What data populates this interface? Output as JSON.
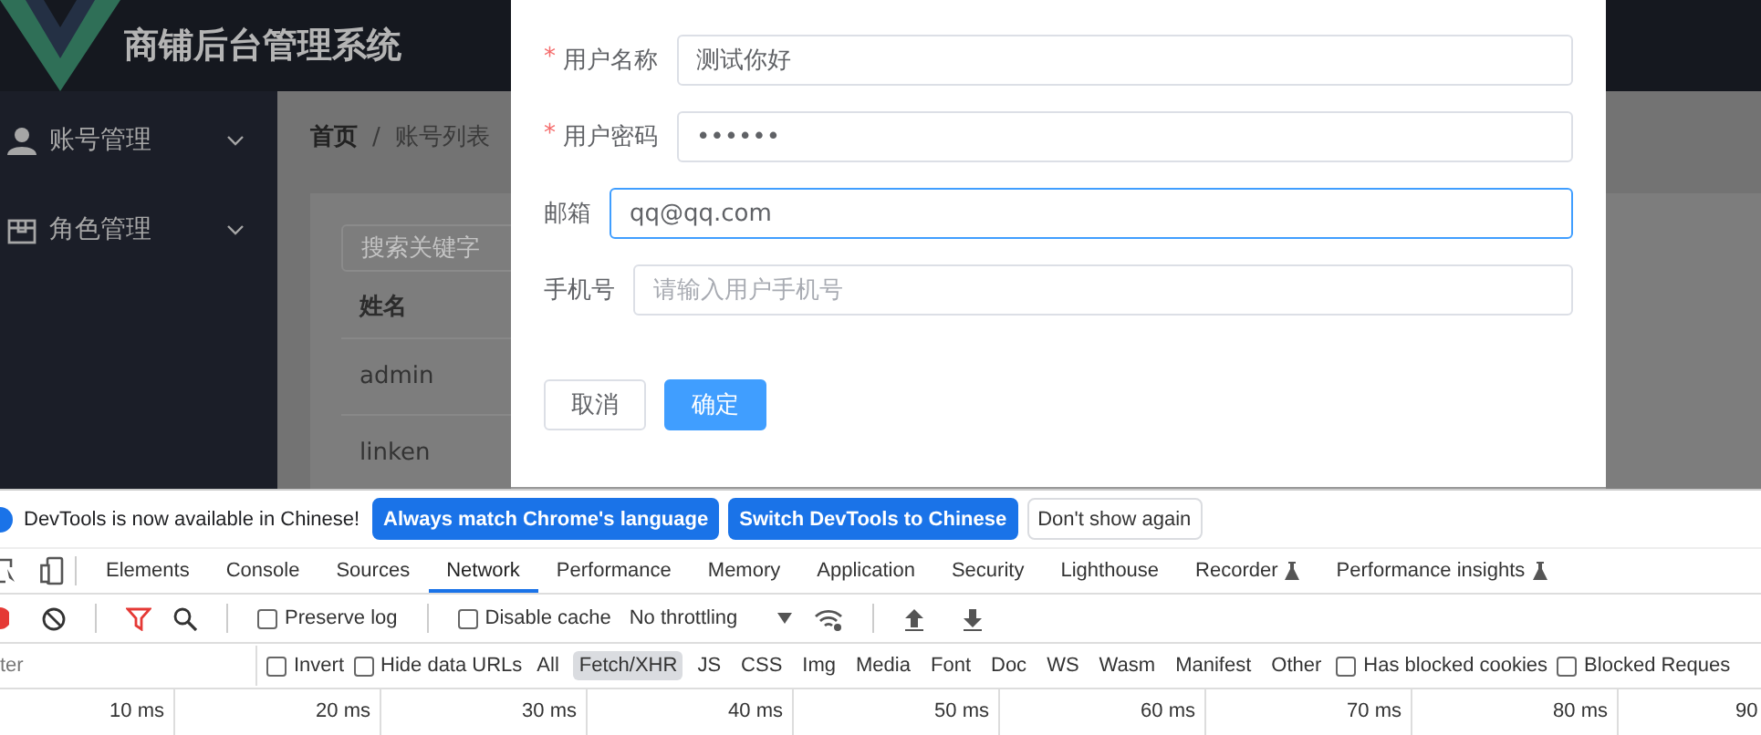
{
  "app": {
    "title": "商铺后台管理系统",
    "menu": [
      {
        "label": "账号管理"
      },
      {
        "label": "角色管理"
      }
    ],
    "breadcrumb": {
      "items": [
        "首页",
        "账号列表"
      ],
      "separator": "/"
    },
    "search": {
      "placeholder": "搜索关键字"
    },
    "table": {
      "columns": [
        "姓名"
      ],
      "rows": [
        [
          "admin"
        ],
        [
          "linken"
        ]
      ]
    }
  },
  "dialog": {
    "fields": [
      {
        "required_mark": "*",
        "label": "用户名称",
        "value": "测试你好",
        "focused": false
      },
      {
        "required_mark": "*",
        "label": "用户密码",
        "value": "••••••",
        "focused": false
      },
      {
        "label": "邮箱",
        "value": "qq@qq.com",
        "focused": true
      },
      {
        "label": "手机号",
        "placeholder": "请输入用户手机号",
        "focused": false
      }
    ],
    "buttons": [
      {
        "label": "取消",
        "kind": "default"
      },
      {
        "label": "确定",
        "kind": "primary"
      }
    ]
  },
  "devtools": {
    "infobar": {
      "message": "DevTools is now available in Chinese!",
      "buttons": [
        {
          "label": "Always match Chrome's language",
          "kind": "primary"
        },
        {
          "label": "Switch DevTools to Chinese",
          "kind": "primary"
        },
        {
          "label": "Don't show again",
          "kind": "plain"
        }
      ]
    },
    "tabs": [
      {
        "label": "Elements",
        "selected": false,
        "experimental": false
      },
      {
        "label": "Console",
        "selected": false,
        "experimental": false
      },
      {
        "label": "Sources",
        "selected": false,
        "experimental": false
      },
      {
        "label": "Network",
        "selected": true,
        "experimental": false
      },
      {
        "label": "Performance",
        "selected": false,
        "experimental": false
      },
      {
        "label": "Memory",
        "selected": false,
        "experimental": false
      },
      {
        "label": "Application",
        "selected": false,
        "experimental": false
      },
      {
        "label": "Security",
        "selected": false,
        "experimental": false
      },
      {
        "label": "Lighthouse",
        "selected": false,
        "experimental": false
      },
      {
        "label": "Recorder",
        "selected": false,
        "experimental": true
      },
      {
        "label": "Performance insights",
        "selected": false,
        "experimental": true
      }
    ],
    "toolbar": {
      "checkboxes": [
        {
          "label": "Preserve log",
          "checked": false
        },
        {
          "label": "Disable cache",
          "checked": false
        }
      ],
      "throttling": "No throttling"
    },
    "filter": {
      "placeholder": "ter",
      "options": [
        {
          "label": "Invert",
          "checked": false
        },
        {
          "label": "Hide data URLs",
          "checked": false
        }
      ],
      "types": [
        {
          "label": "All",
          "selected": false
        },
        {
          "label": "Fetch/XHR",
          "selected": true
        },
        {
          "label": "JS",
          "selected": false
        },
        {
          "label": "CSS",
          "selected": false
        },
        {
          "label": "Img",
          "selected": false
        },
        {
          "label": "Media",
          "selected": false
        },
        {
          "label": "Font",
          "selected": false
        },
        {
          "label": "Doc",
          "selected": false
        },
        {
          "label": "WS",
          "selected": false
        },
        {
          "label": "Wasm",
          "selected": false
        },
        {
          "label": "Manifest",
          "selected": false
        },
        {
          "label": "Other",
          "selected": false
        }
      ],
      "more_options": [
        {
          "label": "Has blocked cookies",
          "checked": false
        },
        {
          "label": "Blocked Reques",
          "checked": false
        }
      ]
    },
    "timeline_ticks": [
      "10 ms",
      "20 ms",
      "30 ms",
      "40 ms",
      "50 ms",
      "60 ms",
      "70 ms",
      "80 ms",
      "90"
    ]
  }
}
